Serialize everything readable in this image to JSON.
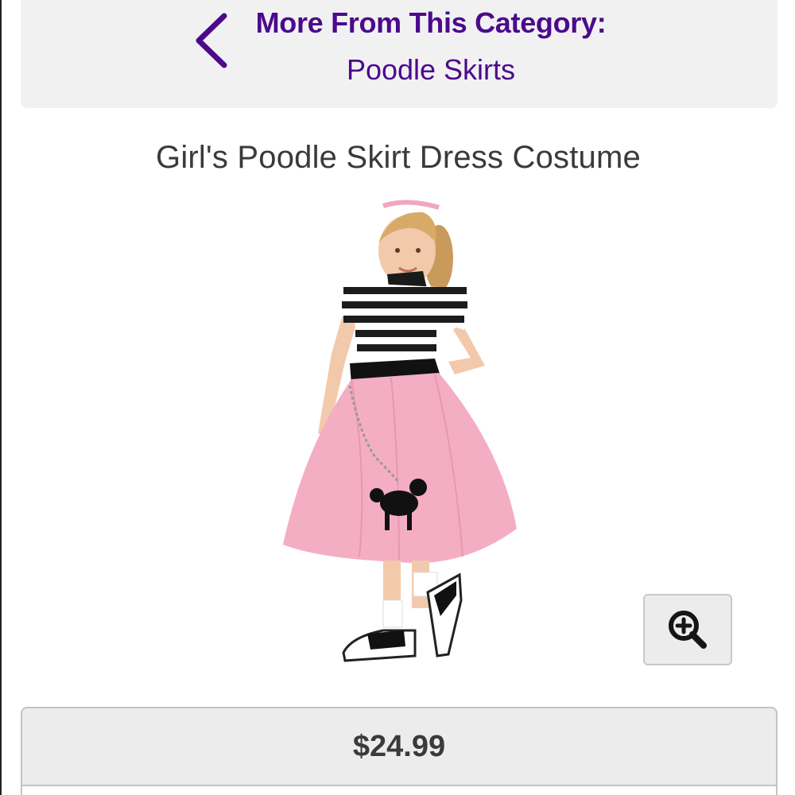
{
  "category_nav": {
    "heading": "More From This Category:",
    "link": "Poodle Skirts",
    "icon": "chevron-left-icon"
  },
  "product": {
    "title": "Girl's Poodle Skirt Dress Costume",
    "price": "$24.99",
    "zoom_icon": "zoom-in-icon"
  },
  "colors": {
    "accent_purple": "#4b0a8c",
    "skirt_pink": "#f4aec4",
    "panel_gray": "#f1f1f2"
  }
}
